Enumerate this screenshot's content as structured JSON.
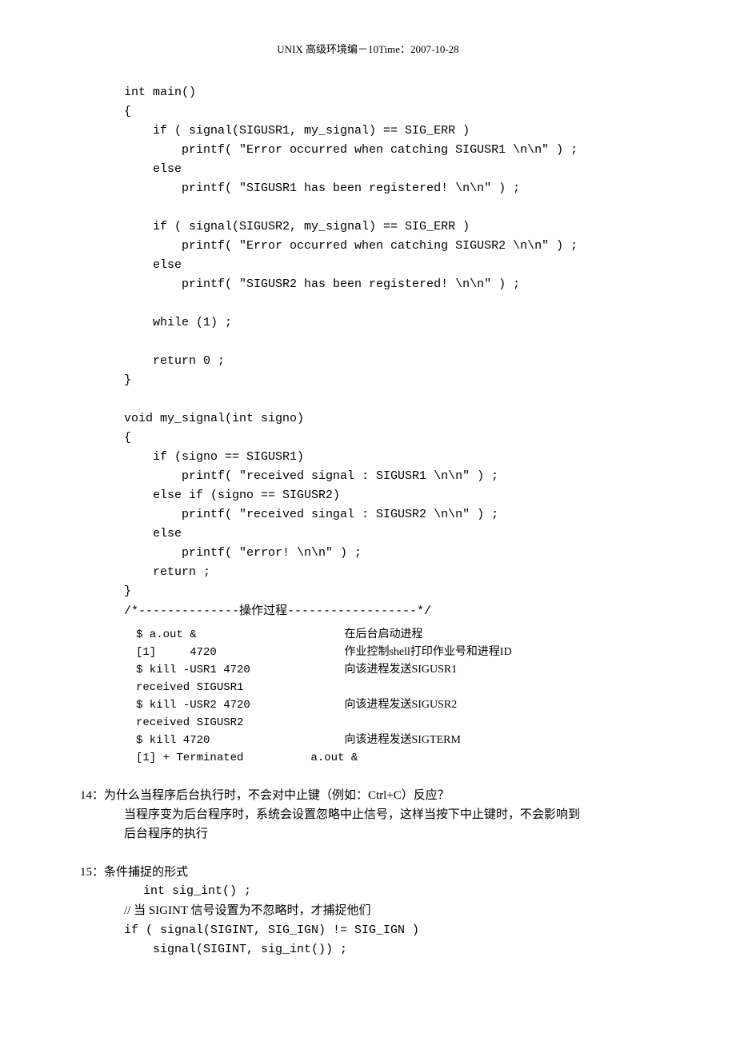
{
  "header": "UNIX 高级环境编－10Time：2007-10-28",
  "code_main": "int main()\n{\n    if ( signal(SIGUSR1, my_signal) == SIG_ERR )\n        printf( \"Error occurred when catching SIGUSR1 \\n\\n\" ) ;\n    else\n        printf( \"SIGUSR1 has been registered! \\n\\n\" ) ;\n\n    if ( signal(SIGUSR2, my_signal) == SIG_ERR )\n        printf( \"Error occurred when catching SIGUSR2 \\n\\n\" ) ;\n    else\n        printf( \"SIGUSR2 has been registered! \\n\\n\" ) ;\n\n    while (1) ;\n\n    return 0 ;\n}\n\nvoid my_signal(int signo)\n{\n    if (signo == SIGUSR1)\n        printf( \"received signal : SIGUSR1 \\n\\n\" ) ;\n    else if (signo == SIGUSR2)\n        printf( \"received singal : SIGUSR2 \\n\\n\" ) ;\n    else\n        printf( \"error! \\n\\n\" ) ;\n    return ;\n}",
  "sep_line_pre": "/*--------------",
  "sep_text": "操作过程",
  "sep_line_post": "------------------*/",
  "fig": {
    "r1l": "$ a.out &",
    "r1r": "在后台启动进程",
    "r2l": "[1]     4720",
    "r2r": "作业控制shell打印作业号和进程ID",
    "r3l": "$ kill -USR1 4720",
    "r3r": "向该进程发送SIGUSR1",
    "r4l": "received SIGUSR1",
    "r4r": "",
    "r5l": "$ kill -USR2 4720",
    "r5r": "向该进程发送SIGUSR2",
    "r6l": "received SIGUSR2",
    "r6r": "",
    "r7l": "$ kill 4720",
    "r7r": "向该进程发送SIGTERM",
    "r8l": "[1] + Terminated          a.out &",
    "r8r": ""
  },
  "q14": "14：为什么当程序后台执行时，不会对中止键（例如：Ctrl+C）反应？",
  "a14a": "当程序变为后台程序时，系统会设置忽略中止信号，这样当按下中止键时，不会影响到",
  "a14b": "后台程序的执行",
  "q15": "15：条件捕捉的形式",
  "c15a": " int sig_int() ;",
  "c15b": "// 当 SIGINT 信号设置为不忽略时，才捕捉他们",
  "c15c": "if ( signal(SIGINT, SIG_IGN) != SIG_IGN )\n    signal(SIGINT, sig_int()) ;"
}
